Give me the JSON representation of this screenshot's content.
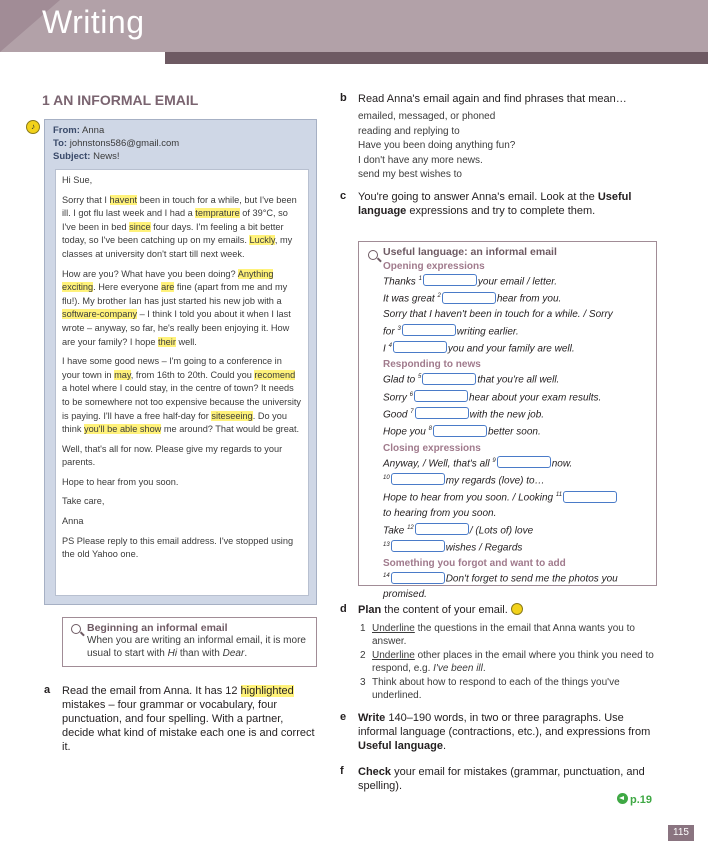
{
  "header": {
    "title": "Writing"
  },
  "section": {
    "title": "1 AN INFORMAL EMAIL"
  },
  "email": {
    "from_label": "From:",
    "from": "Anna",
    "to_label": "To:",
    "to": "johnstons586@gmail.com",
    "subject_label": "Subject:",
    "subject": "News!",
    "greeting": "Hi Sue,",
    "p1": [
      "Sorry that I ",
      "havent",
      " been in touch for a while, but I've been ill. I got flu last week and I had a ",
      "temprature",
      " of 39°C, so I've been in bed ",
      "since",
      " four days. I'm feeling a bit better today, so I've been catching up on my emails. ",
      "Luckly",
      ", my classes at university don't start till next week."
    ],
    "p2": [
      "How are you? What have you been doing? ",
      "Anything exciting",
      ". Here everyone ",
      "are",
      " fine (apart from me and my flu!). My brother Ian has just started his new job with a ",
      "software-company",
      " – I think I told you about it when I last wrote – anyway, so far, he's really been enjoying it. How are your family? I hope ",
      "their",
      " well."
    ],
    "p3": [
      "I have some good news – I'm going to a conference in your town in ",
      "may",
      ", from 16th to 20th. Could you ",
      "recomend",
      " a hotel where I could stay, in the centre of town? It needs to be somewhere not too expensive because the university is paying. I'll have a free half-day for ",
      "siteseeing",
      ". Do you think ",
      "you'll be able show",
      " me around? That would be great."
    ],
    "p4": "Well, that's all for now. Please give my regards to your parents.",
    "p5": "Hope to hear from you soon.",
    "p6": "Take care,",
    "p7": "Anna",
    "p8": "PS Please reply to this email address. I've stopped using the old Yahoo one."
  },
  "tip": {
    "title": "Beginning an informal email",
    "text_a": "When you are writing an informal email, it is more usual to start with ",
    "hi": "Hi",
    "text_b": " than with ",
    "dear": "Dear",
    "text_c": "."
  },
  "task_a": {
    "letter": "a",
    "text_a": "Read the email from Anna. It has 12 ",
    "highlighted": "highlighted",
    "text_b": " mistakes – four grammar or vocabulary, four punctuation, and four spelling. With a partner, decide what kind of mistake each one is and correct it."
  },
  "task_b": {
    "letter": "b",
    "text": "Read Anna's email again and find phrases that mean…",
    "phrases": [
      "emailed, messaged, or phoned",
      "reading and replying to",
      "Have you been doing anything fun?",
      "I don't have any more news.",
      "send my best wishes to"
    ]
  },
  "task_c": {
    "letter": "c",
    "text_a": "You're going to answer Anna's email. Look at the ",
    "bold": "Useful language",
    "text_b": " expressions and try to complete them."
  },
  "useful": {
    "title": "Useful language: an informal email",
    "opening": "Opening expressions",
    "o1a": "Thanks ",
    "o1n": "1",
    "o1b": "your email / letter.",
    "o2a": "It was great ",
    "o2n": "2",
    "o2b": "hear from you.",
    "o3": "Sorry that I haven't been in touch for a while. / Sorry",
    "o4a": "for ",
    "o4n": "3",
    "o4b": "writing earlier.",
    "o5a": "I ",
    "o5n": "4",
    "o5b": "you and your family are well.",
    "responding": "Responding to news",
    "r1a": "Glad to ",
    "r1n": "5",
    "r1b": "that you're all well.",
    "r2a": "Sorry ",
    "r2n": "6",
    "r2b": "hear about your exam results.",
    "r3a": "Good ",
    "r3n": "7",
    "r3b": "with the new job.",
    "r4a": "Hope you ",
    "r4n": "8",
    "r4b": "better soon.",
    "closing": "Closing expressions",
    "c1a": "Anyway, / Well, that's all ",
    "c1n": "9",
    "c1b": "now.",
    "c2n": "10",
    "c2b": "my regards (love) to…",
    "c3a": "Hope to hear from you soon. / Looking ",
    "c3n": "11",
    "c4": "to hearing from you soon.",
    "c5a": "Take ",
    "c5n": "12",
    "c5b": "/ (Lots of) love",
    "c6n": "13",
    "c6b": "wishes / Regards",
    "forgot": "Something you forgot and want to add",
    "f1n": "14",
    "f1b": "Don't forget to send me the photos you",
    "f2": "promised."
  },
  "task_d": {
    "letter": "d",
    "bold": "Plan",
    "text": " the content of your email.",
    "items": [
      {
        "num": "1",
        "u": "Underline",
        "rest": " the questions in the email that Anna wants you to answer."
      },
      {
        "num": "2",
        "u": "Underline",
        "rest": " other places in the email where you think you need to respond, e.g. ",
        "eg": "I've been ill",
        "end": "."
      },
      {
        "num": "3",
        "rest": "Think about how to respond to each of the things you've underlined."
      }
    ]
  },
  "task_e": {
    "letter": "e",
    "bold": "Write",
    "text_a": " 140–190 words, in two or three paragraphs. Use informal language (contractions, etc.), and expressions from ",
    "bold2": "Useful language",
    "text_b": "."
  },
  "task_f": {
    "letter": "f",
    "bold": "Check",
    "text": " your email for mistakes (grammar, punctuation, and spelling)."
  },
  "link": {
    "label": "p.19"
  },
  "page": {
    "number": "115"
  },
  "colors": {
    "header": "#b2a1a8",
    "accent": "#6e5a63",
    "highlight": "#fff27a",
    "email_frame": "#cfd7e6",
    "link": "#3fa844"
  },
  "icons": [
    "audio-icon",
    "magnifier-icon",
    "pencil-icon",
    "arrow-icon"
  ]
}
